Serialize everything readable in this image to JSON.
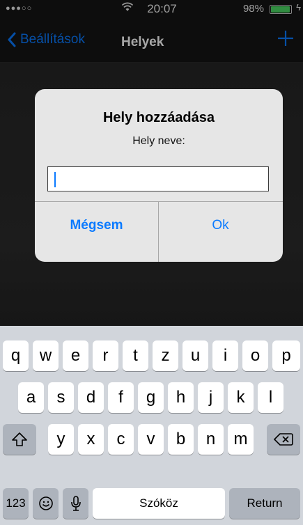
{
  "status_bar": {
    "signal": "●●●○○",
    "time": "20:07",
    "battery": "98%"
  },
  "nav": {
    "back_label": "Beállítások",
    "title": "Helyek"
  },
  "alert": {
    "title": "Hely hozzáadása",
    "message": "Hely neve:",
    "input_value": "",
    "cancel_label": "Mégsem",
    "ok_label": "Ok"
  },
  "keyboard": {
    "row1": [
      "q",
      "w",
      "e",
      "r",
      "t",
      "z",
      "u",
      "i",
      "o",
      "p"
    ],
    "row2": [
      "a",
      "s",
      "d",
      "f",
      "g",
      "h",
      "j",
      "k",
      "l"
    ],
    "row3": [
      "y",
      "x",
      "c",
      "v",
      "b",
      "n",
      "m"
    ],
    "numbers_label": "123",
    "space_label": "Szóköz",
    "return_label": "Return"
  },
  "colors": {
    "accent": "#0a7aff",
    "battery": "#4cd964",
    "keyboard_bg": "#d1d5db"
  }
}
